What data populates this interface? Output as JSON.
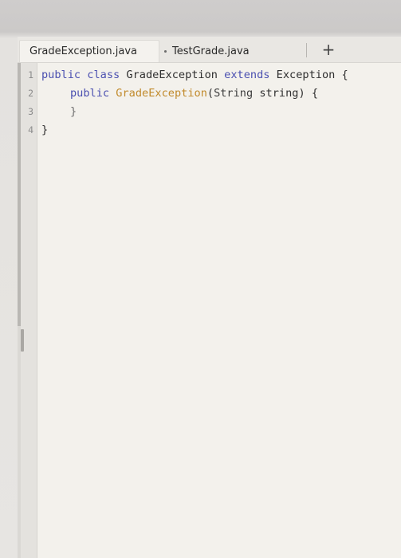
{
  "tabs": [
    {
      "label": "GradeException.java",
      "active": true
    },
    {
      "label": "TestGrade.java",
      "active": false
    }
  ],
  "add_tab_label": "+",
  "code": {
    "lines": [
      {
        "number": "1",
        "tokens": {
          "t1": "public",
          "t2": " class ",
          "t3": "GradeException",
          "t4": " extends ",
          "t5": "Exception",
          "t6": " {"
        }
      },
      {
        "number": "2",
        "tokens": {
          "t1": "public",
          "t2": " ",
          "t3": "GradeException",
          "t4": "(",
          "t5": "String",
          "t6": " string) {"
        }
      },
      {
        "number": "3",
        "tokens": {
          "t1": "}"
        }
      },
      {
        "number": "4",
        "tokens": {
          "t1": "}"
        }
      }
    ]
  },
  "colors": {
    "keyword": "#4a4fb0",
    "constructor": "#c18a2b",
    "text": "#2f2f2f",
    "line_number": "#8c8c8c",
    "editor_bg": "#f3f1ec"
  }
}
